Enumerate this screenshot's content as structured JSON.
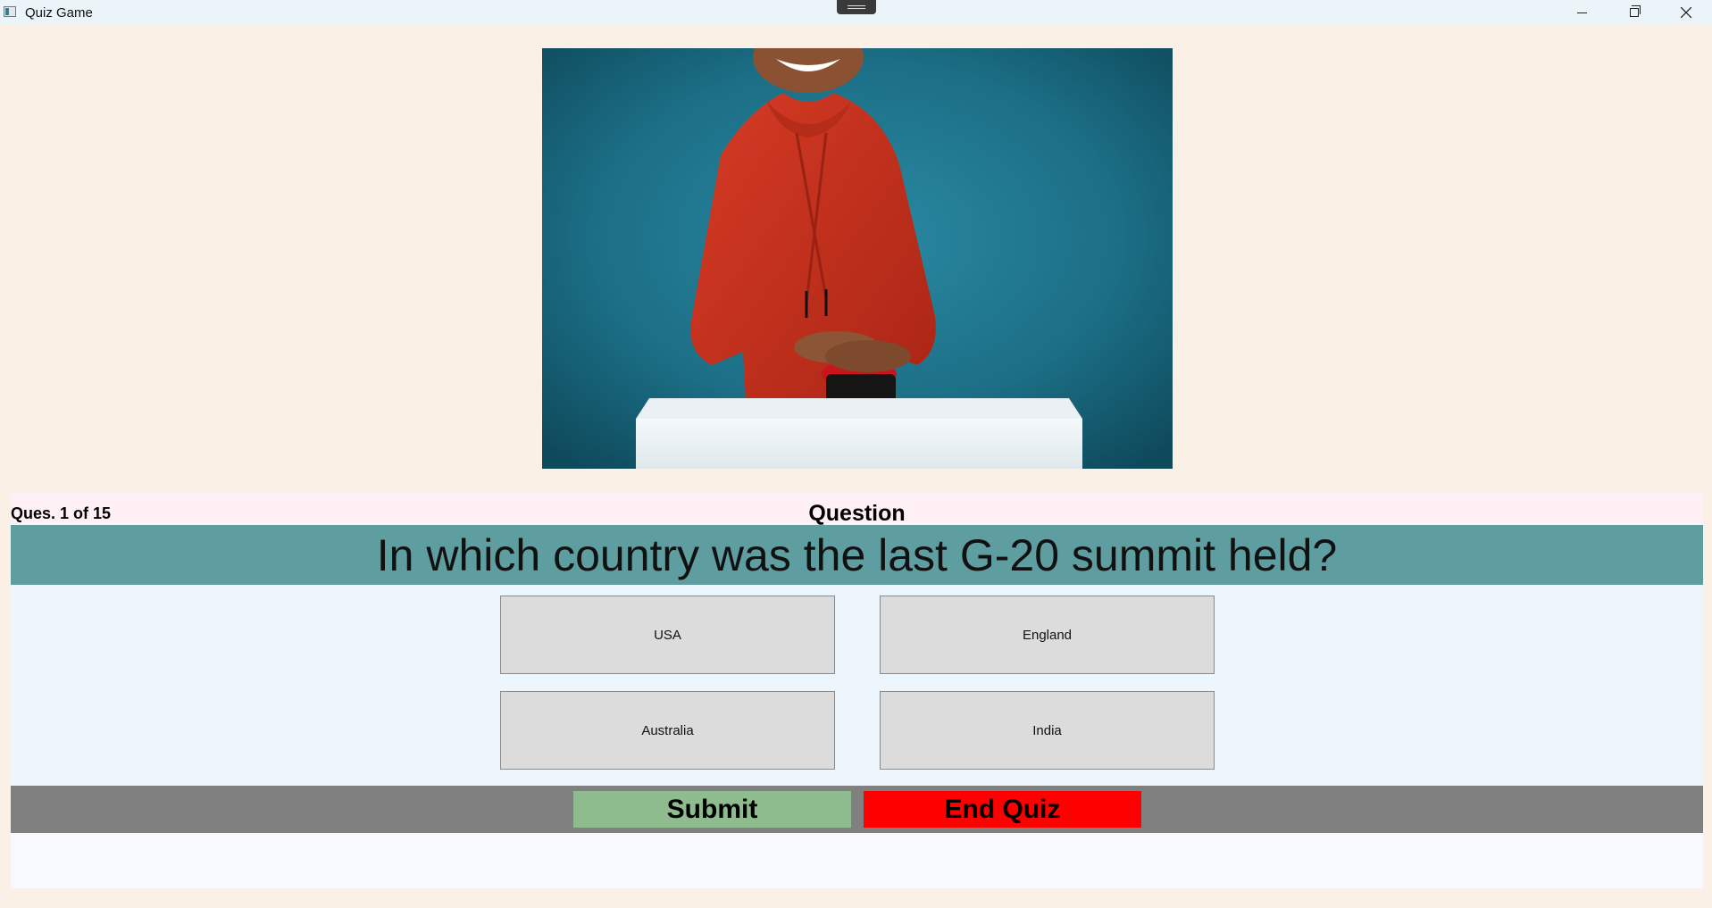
{
  "window": {
    "title": "Quiz Game",
    "icon": "app-window-icon",
    "controls": [
      "minimize-icon",
      "restore-icon",
      "close-icon"
    ]
  },
  "hero_image": {
    "description": "person in red hoodie pressing a red buzzer button",
    "background_color": "#1d6f86"
  },
  "question": {
    "counter": "Ques. 1 of 15",
    "label": "Question",
    "text": "In which country was the last G-20 summit held?"
  },
  "options": [
    "USA",
    "England",
    "Australia",
    "India"
  ],
  "actions": {
    "submit": "Submit",
    "end_quiz": "End Quiz"
  },
  "colors": {
    "background": "#faf0e6",
    "question_bar": "#5f9ea0",
    "submit": "#8fbc8f",
    "end_quiz": "#ff0000",
    "action_bar": "#808080"
  }
}
